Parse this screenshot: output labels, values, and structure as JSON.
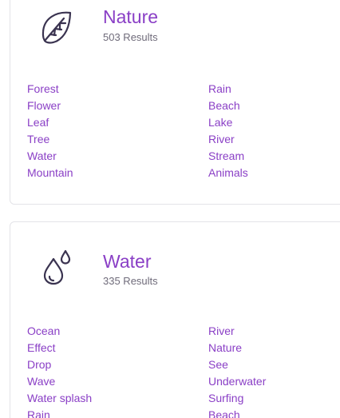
{
  "categories": [
    {
      "icon": "leaf-icon",
      "title": "Nature",
      "count": "503 Results",
      "tags_left": [
        "Forest",
        "Flower",
        "Leaf",
        "Tree",
        "Water",
        "Mountain"
      ],
      "tags_right": [
        "Rain",
        "Beach",
        "Lake",
        "River",
        "Stream",
        "Animals"
      ]
    },
    {
      "icon": "water-drops-icon",
      "title": "Water",
      "count": "335 Results",
      "tags_left": [
        "Ocean",
        "Effect",
        "Drop",
        "Wave",
        "Water splash",
        "Rain"
      ],
      "tags_right": [
        "River",
        "Nature",
        "See",
        "Underwater",
        "Surfing",
        "Beach"
      ]
    }
  ],
  "colors": {
    "accent": "#8a3fc6",
    "icon": "#3a3350",
    "muted_text": "#6f6b7a",
    "card_border": "#e3e3e8"
  }
}
